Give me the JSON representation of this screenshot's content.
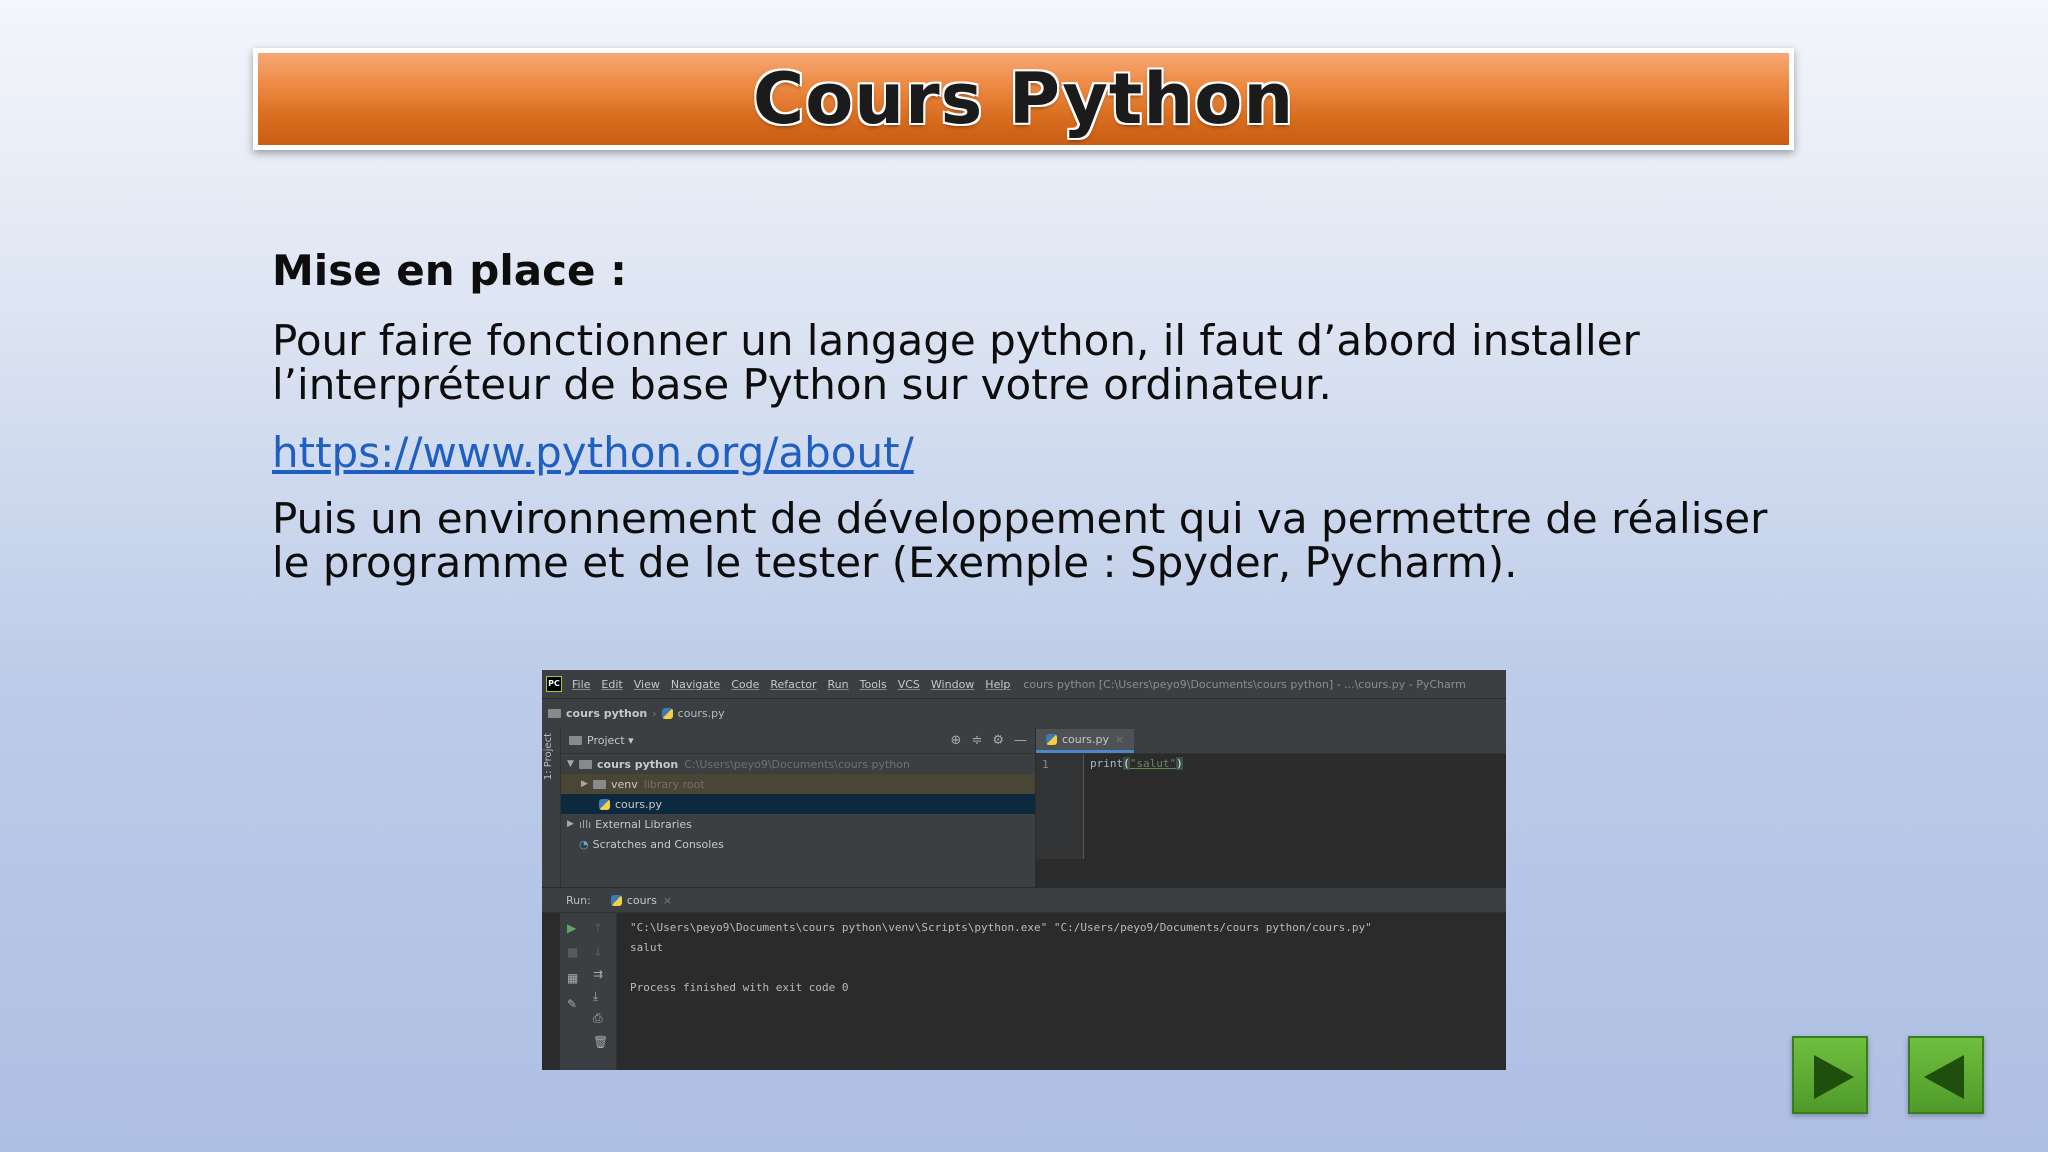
{
  "slide": {
    "title": "Cours Python",
    "heading": "Mise en place :",
    "para1_line1": "Pour faire fonctionner un langage python, il faut d’abord installer",
    "para1_line2": "l’interpréteur de base Python sur votre ordinateur.",
    "link": "https://www.python.org/about/",
    "para2_line1": "Puis un environnement de développement qui va permettre de réaliser",
    "para2_line2": "le programme et de le tester (Exemple : Spyder, Pycharm)."
  },
  "ide": {
    "app_icon": "PC",
    "menu": [
      "File",
      "Edit",
      "View",
      "Navigate",
      "Code",
      "Refactor",
      "Run",
      "Tools",
      "VCS",
      "Window",
      "Help"
    ],
    "window_path": "cours python [C:\\Users\\peyo9\\Documents\\cours python] - ...\\cours.py - PyCharm",
    "breadcrumb_project": "cours python",
    "breadcrumb_file": "cours.py",
    "side_label": "1: Project",
    "project_pane_title": "Project ▾",
    "tree": {
      "root_label": "cours python",
      "root_path": "C:\\Users\\peyo9\\Documents\\cours python",
      "venv_label": "venv",
      "venv_hint": "library root",
      "file_label": "cours.py",
      "ext_libs": "External Libraries",
      "scratches": "Scratches and Consoles"
    },
    "editor_tab": "cours.py",
    "line_number": "1",
    "code_fn": "print",
    "code_str": "\"salut\"",
    "run_label": "Run:",
    "run_tab": "cours",
    "console_line1": "\"C:\\Users\\peyo9\\Documents\\cours python\\venv\\Scripts\\python.exe\" \"C:/Users/peyo9/Documents/cours python/cours.py\"",
    "console_line2": "salut",
    "console_line3": "Process finished with exit code 0"
  },
  "navigation": {
    "next_icon": "play-right-icon",
    "prev_icon": "play-left-icon"
  },
  "colors": {
    "title_orange": "#e07a2c",
    "link_blue": "#1f5fbf",
    "nav_green": "#5aa832"
  }
}
